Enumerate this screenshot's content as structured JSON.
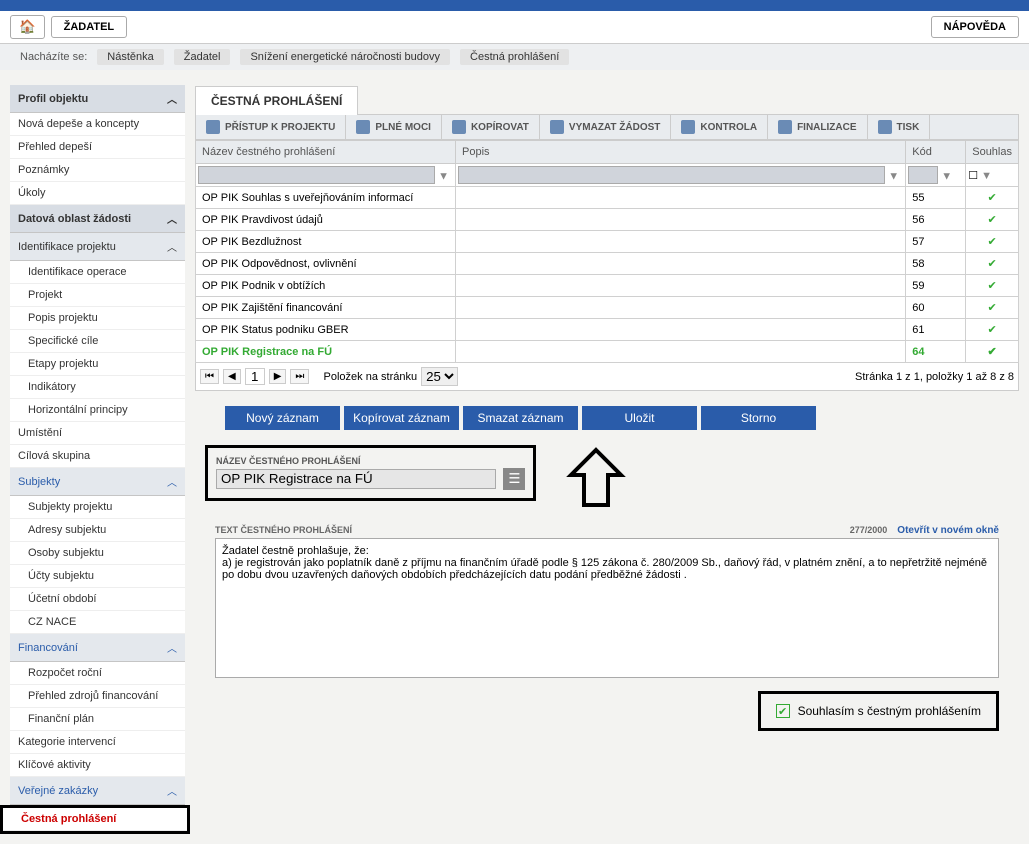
{
  "nav": {
    "zadatel": "ŽADATEL",
    "napoveda": "NÁPOVĚDA"
  },
  "breadcrumb": {
    "label": "Nacházíte se:",
    "items": [
      "Nástěnka",
      "Žadatel",
      "Snížení energetické náročnosti budovy",
      "Čestná prohlášení"
    ]
  },
  "sidebar": {
    "s1": "Profil objektu",
    "i1": "Nová depeše a koncepty",
    "i2": "Přehled depeší",
    "i3": "Poznámky",
    "i4": "Úkoly",
    "s2": "Datová oblast žádosti",
    "s3": "Identifikace projektu",
    "i5": "Identifikace operace",
    "i6": "Projekt",
    "i7": "Popis projektu",
    "i8": "Specifické cíle",
    "i9": "Etapy projektu",
    "i10": "Indikátory",
    "i11": "Horizontální principy",
    "i12": "Umístění",
    "i13": "Cílová skupina",
    "s4": "Subjekty",
    "i14": "Subjekty projektu",
    "i15": "Adresy subjektu",
    "i16": "Osoby subjektu",
    "i17": "Účty subjektu",
    "i18": "Účetní období",
    "i19": "CZ NACE",
    "s5": "Financování",
    "i20": "Rozpočet roční",
    "i21": "Přehled zdrojů financování",
    "i22": "Finanční plán",
    "i23": "Kategorie intervencí",
    "i24": "Klíčové aktivity",
    "s6": "Veřejné zakázky",
    "i25": "Čestná prohlášení"
  },
  "tab": "ČESTNÁ PROHLÁŠENÍ",
  "tools": {
    "pristup": "PŘÍSTUP K PROJEKTU",
    "plne": "PLNÉ MOCI",
    "kopirovat": "KOPÍROVAT",
    "vymazat": "VYMAZAT ŽÁDOST",
    "kontrola": "KONTROLA",
    "finalizace": "FINALIZACE",
    "tisk": "TISK"
  },
  "grid": {
    "h1": "Název čestného prohlášení",
    "h2": "Popis",
    "h3": "Kód",
    "h4": "Souhlas",
    "r0": {
      "n": "OP PIK Souhlas s uveřejňováním informací",
      "k": "55"
    },
    "r1": {
      "n": "OP PIK Pravdivost údajů",
      "k": "56"
    },
    "r2": {
      "n": "OP PIK Bezdlužnost",
      "k": "57"
    },
    "r3": {
      "n": "OP PIK Odpovědnost, ovlivnění",
      "k": "58"
    },
    "r4": {
      "n": "OP PIK Podnik v obtížích",
      "k": "59"
    },
    "r5": {
      "n": "OP PIK Zajištění financování",
      "k": "60"
    },
    "r6": {
      "n": "OP PIK Status podniku GBER",
      "k": "61"
    },
    "r7": {
      "n": "OP PIK Registrace na FÚ",
      "k": "64"
    }
  },
  "pager": {
    "page": "1",
    "perpage_label": "Položek na stránku",
    "perpage": "25",
    "info": "Stránka 1 z 1, položky 1 až 8 z 8"
  },
  "actions": {
    "novy": "Nový záznam",
    "kopirovat": "Kopírovat záznam",
    "smazat": "Smazat záznam",
    "ulozit": "Uložit",
    "storno": "Storno"
  },
  "form": {
    "nazev_label": "NÁZEV ČESTNÉHO PROHLÁŠENÍ",
    "nazev_value": "OP PIK Registrace na FÚ",
    "text_label": "TEXT ČESTNÉHO PROHLÁŠENÍ",
    "counter": "277/2000",
    "open_new": "Otevřít v novém okně",
    "text_value": "Žadatel čestně prohlašuje, že:\na) je registrován jako poplatník daně z příjmu na finančním úřadě podle § 125 zákona č. 280/2009 Sb., daňový řád, v platném znění, a to nepřetržitě nejméně po dobu dvou uzavřených daňových obdobích předcházejících datu podání předběžné žádosti .",
    "agree": "Souhlasím s čestným prohlášením"
  }
}
